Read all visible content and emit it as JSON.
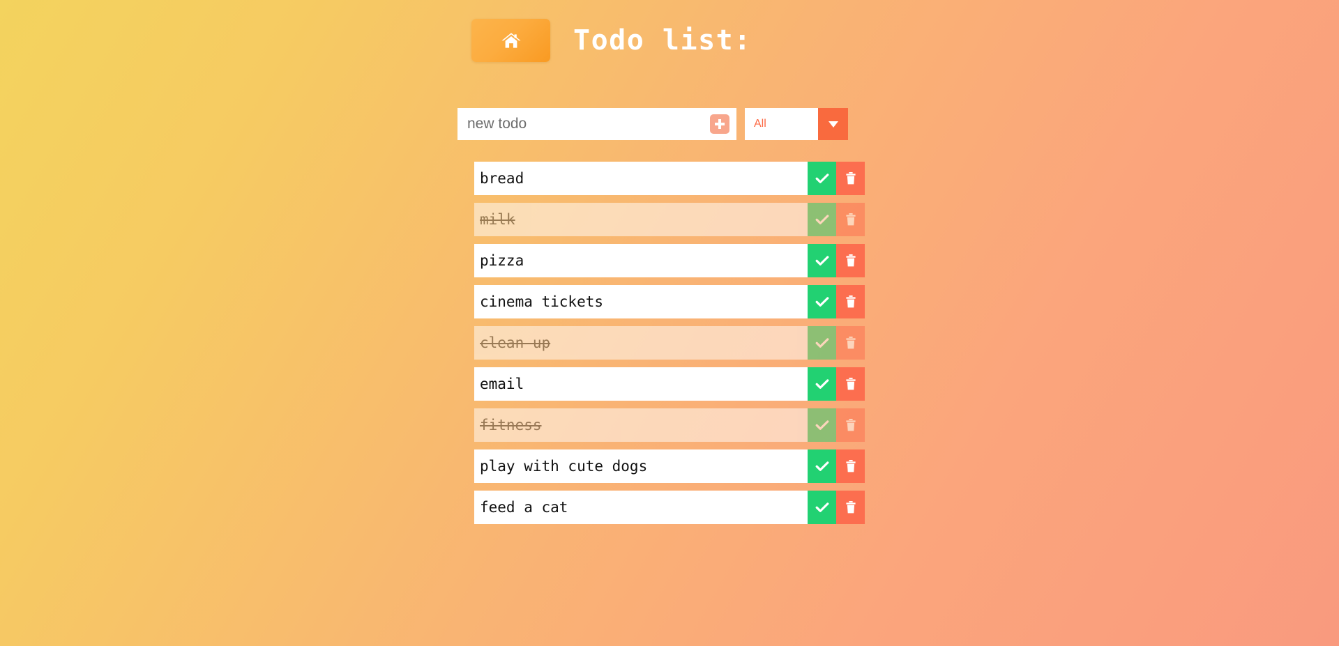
{
  "header": {
    "home_button_icon": "home-icon",
    "title": "Todo list:"
  },
  "controls": {
    "new_todo_placeholder": "new todo",
    "new_todo_value": "",
    "add_button_icon": "plus-icon",
    "filter_selected": "All",
    "filter_toggle_icon": "chevron-down-icon",
    "filter_options": [
      "All"
    ]
  },
  "row_actions": {
    "toggle_icon": "check-icon",
    "delete_icon": "trash-icon"
  },
  "colors": {
    "background_start": "#f3d35e",
    "background_end": "#f99a7e",
    "home_button": "#fcac3f",
    "add_button": "#f8a68c",
    "filter_text": "#fd6a45",
    "filter_toggle": "#f96a3e",
    "toggle_green": "#22d172",
    "delete_red": "#fc6e4f",
    "title_text": "#ffffff"
  },
  "todos": [
    {
      "label": "bread",
      "completed": false
    },
    {
      "label": "milk",
      "completed": true
    },
    {
      "label": "pizza",
      "completed": false
    },
    {
      "label": "cinema tickets",
      "completed": false
    },
    {
      "label": "clean up",
      "completed": true
    },
    {
      "label": "email",
      "completed": false
    },
    {
      "label": "fitness",
      "completed": true
    },
    {
      "label": "play with cute dogs",
      "completed": false
    },
    {
      "label": "feed a cat",
      "completed": false
    }
  ]
}
